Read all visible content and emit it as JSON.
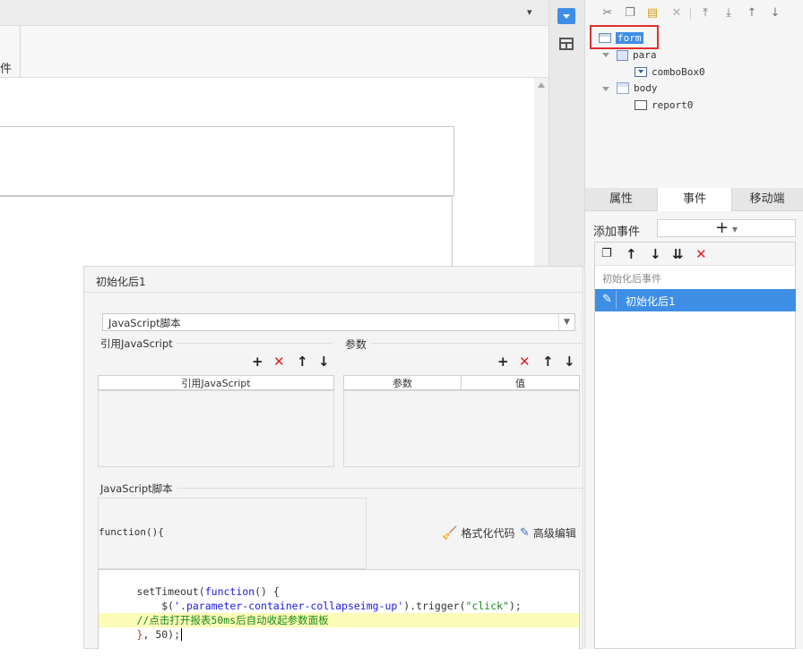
{
  "editor": {
    "tab_label": "件"
  },
  "tree": {
    "toolbar_icons": [
      "cut-icon",
      "copy-icon",
      "paste-icon",
      "delete-icon",
      "move-top-icon",
      "move-bottom-icon",
      "move-up-icon",
      "move-down-icon"
    ],
    "nodes": [
      {
        "label": "form"
      },
      {
        "label": "para"
      },
      {
        "label": "comboBox0"
      },
      {
        "label": "body"
      },
      {
        "label": "report0"
      }
    ],
    "highlight_color": "#e03030",
    "selected_bg": "#3e8ee6"
  },
  "tabs": [
    {
      "label": "属性"
    },
    {
      "label": "事件"
    },
    {
      "label": "移动端"
    }
  ],
  "events": {
    "add_label": "添加事件",
    "add_button": "+",
    "group_label": "初始化后事件",
    "items": [
      {
        "label": "初始化后1"
      }
    ]
  },
  "dialog": {
    "title": "初始化后1",
    "script_type": "JavaScript脚本",
    "ref_section": "引用JavaScript",
    "param_section": "参数",
    "ref_col": "引用JavaScript",
    "param_cols": [
      "参数",
      "值"
    ],
    "script_section": "JavaScript脚本",
    "func_header": "function(){",
    "format_btn": "格式化代码",
    "advanced_btn": "高级编辑",
    "code": {
      "l1a": "setTimeout(",
      "l1b": "function",
      "l1c": "() {",
      "l2a": "    $(",
      "l2b": "'.parameter-container-collapseimg-up'",
      "l2c": ").trigger(",
      "l2d": "\"click\"",
      "l2e": ");",
      "l3": "//点击打开报表50ms后自动收起参数面板",
      "l4a": "}",
      "l4b": ", 50);"
    }
  }
}
